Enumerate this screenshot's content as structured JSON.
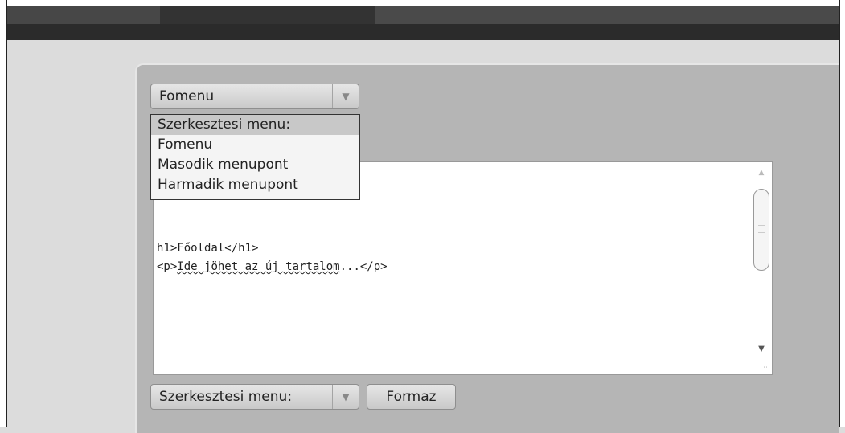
{
  "menu_select": {
    "value": "Fomenu",
    "options": [
      "Szerkesztesi menu:",
      "Fomenu",
      "Masodik menupont",
      "Harmadik menupont"
    ]
  },
  "editor": {
    "lines": [
      "h1>Főoldal</h1>",
      {
        "prefix": "<p>",
        "squiggly": "Ide jöhet az új tartalom",
        "suffix": "...</p>"
      }
    ]
  },
  "bottom_select": {
    "value": "Szerkesztesi menu:"
  },
  "format_button": {
    "label": "Formaz"
  },
  "icons": {
    "dropdown_arrow": "chevron-down-icon",
    "scroll_up": "scroll-up-icon",
    "scroll_down": "scroll-down-icon",
    "resize": "resize-grip-icon"
  }
}
